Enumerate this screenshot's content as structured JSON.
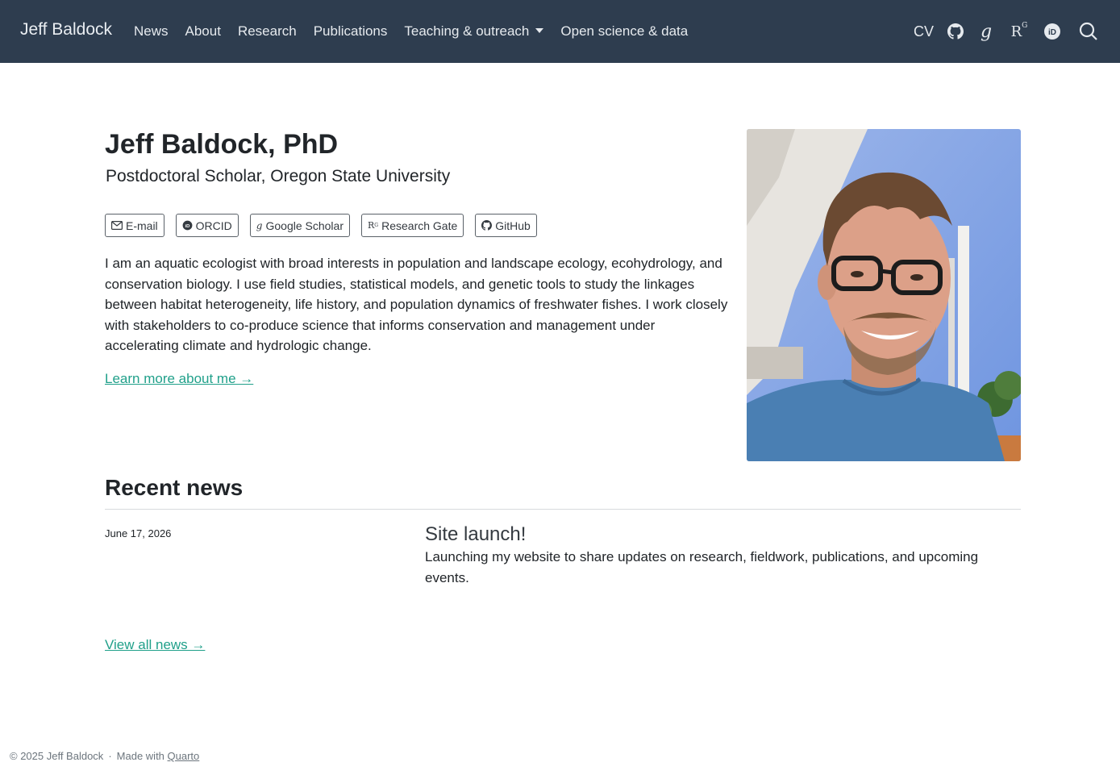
{
  "navbar": {
    "brand": "Jeff Baldock",
    "links": [
      "News",
      "About",
      "Research",
      "Publications",
      "Teaching & outreach",
      "Open science & data"
    ],
    "cv_label": "CV",
    "icons": [
      "github-icon",
      "google-scholar-icon",
      "researchgate-icon",
      "orcid-icon",
      "search-icon"
    ]
  },
  "hero": {
    "name": "Jeff Baldock, PhD",
    "subtitle": "Postdoctoral Scholar, Oregon State University",
    "badges": [
      {
        "label": "E-mail",
        "icon": "envelope-icon"
      },
      {
        "label": "ORCID",
        "icon": "orcid-icon"
      },
      {
        "label": "Google Scholar",
        "icon": "google-scholar-icon"
      },
      {
        "label": "Research Gate",
        "icon": "researchgate-icon"
      },
      {
        "label": "GitHub",
        "icon": "github-icon"
      }
    ],
    "bio": "I am an aquatic ecologist with broad interests in population and landscape ecology, ecohydrology, and conservation biology. I use field studies, statistical models, and genetic tools to study the linkages between habitat heterogeneity, life history, and population dynamics of freshwater fishes. I work closely with stakeholders to co-produce science that informs conservation and management under accelerating climate and hydrologic change.",
    "learn_more": "Learn more about me →"
  },
  "news": {
    "heading": "Recent news",
    "items": [
      {
        "date": "June 17, 2026",
        "title": "Site launch!",
        "text": "Launching my website to share updates on research, fieldwork, publications, and upcoming events."
      }
    ],
    "view_all": "View all news →"
  },
  "footer": {
    "copyright": "© 2025 Jeff Baldock",
    "made_with": "Made with",
    "quarto": "Quarto"
  },
  "colors": {
    "navbar_bg": "#2e3d4f",
    "link_accent": "#20a08a"
  }
}
